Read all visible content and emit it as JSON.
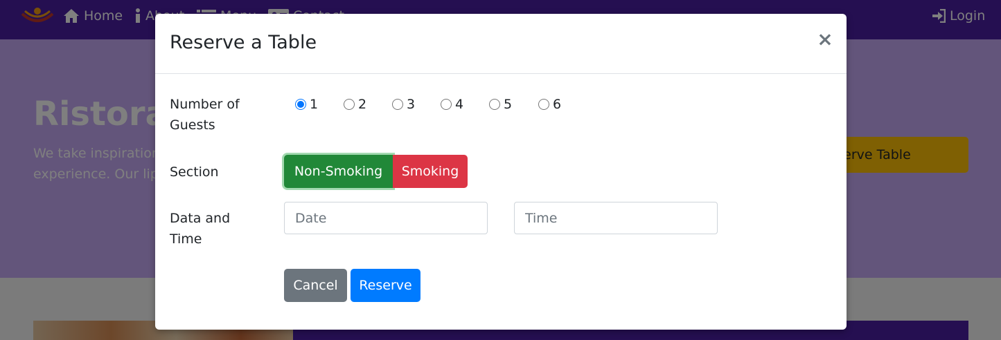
{
  "navbar": {
    "home": "Home",
    "about": "About",
    "menu": "Menu",
    "contact": "Contact",
    "login": "Login"
  },
  "hero": {
    "title": "Ristorante Con Fusion",
    "text": "We take inspiration from the World's best cuisines, and create a unique fusion experience. Our lipsmacking creations will tickle your culinary senses!",
    "button": "Reserve Table"
  },
  "modal": {
    "title": "Reserve a Table",
    "close": "×",
    "guests_label": "Number of Guests",
    "guest_options": [
      "1",
      "2",
      "3",
      "4",
      "5",
      "6"
    ],
    "guests_selected": "1",
    "section_label": "Section",
    "section_options": [
      "Non-Smoking",
      "Smoking"
    ],
    "section_selected": "Non-Smoking",
    "datetime_label": "Data and Time",
    "date_placeholder": "Date",
    "time_placeholder": "Time",
    "cancel": "Cancel",
    "reserve": "Reserve"
  },
  "colors": {
    "navbar": "#4b1fa3",
    "jumbotron": "#c7aaf6",
    "success": "#218838",
    "danger": "#dc3545",
    "secondary": "#6c757d",
    "primary": "#007bff",
    "warning": "#ffc107"
  }
}
